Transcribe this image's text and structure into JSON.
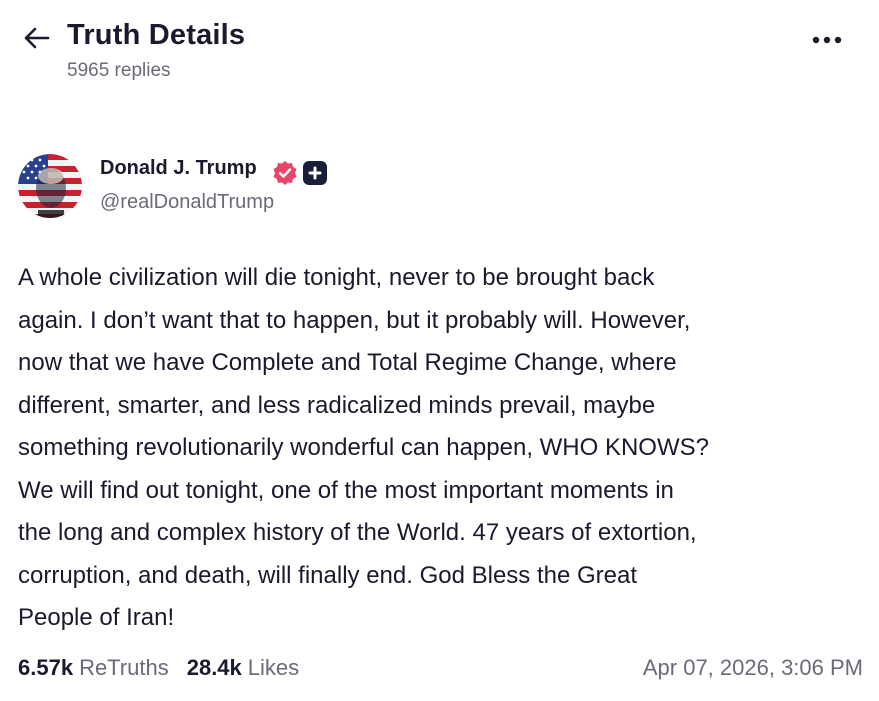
{
  "header": {
    "title": "Truth Details",
    "replies": "5965 replies"
  },
  "post": {
    "author_name": "Donald J. Trump",
    "handle": "@realDonaldTrump",
    "text": "A whole civilization will die tonight, never to be brought back\nagain. I don’t want that to happen, but it probably will. However,\nnow that we have Complete and Total Regime Change, where\ndifferent, smarter, and less radicalized minds prevail, maybe\nsomething revolutionarily wonderful can happen, WHO KNOWS?\nWe will find out tonight, one of the most important moments in\nthe long and complex history of the World. 47 years of extortion,\ncorruption, and death, will finally end. God Bless the Great\nPeople of Iran!",
    "retruths_count": "6.57k",
    "retruths_label": "ReTruths",
    "likes_count": "28.4k",
    "likes_label": "Likes",
    "timestamp": "Apr 07, 2026, 3:06 PM"
  },
  "icons": {
    "back": "back-arrow-icon",
    "more": "more-options-icon",
    "verified": "verified-badge-icon",
    "plus": "plus-badge-icon"
  },
  "colors": {
    "verified": "#e8456b",
    "text": "#1a1a2e",
    "muted": "#6b6b78"
  }
}
